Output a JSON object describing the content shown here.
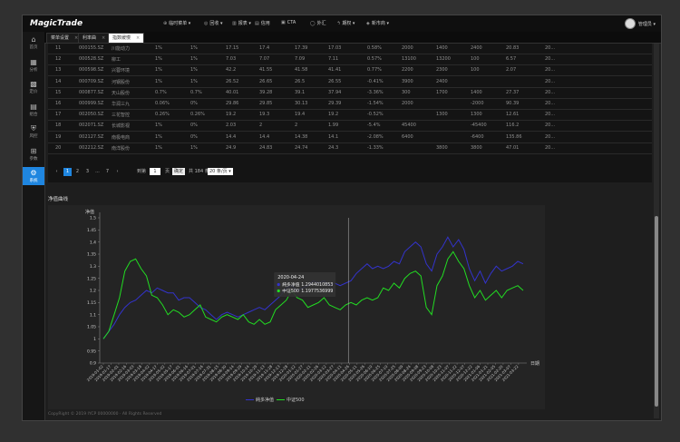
{
  "app": {
    "logo": "MagicTrade"
  },
  "topbar": {
    "menus": [
      {
        "icon": "⊕",
        "icon_name": "add-circle-icon",
        "label": "临时菜单 ▾"
      },
      {
        "icon": "◎",
        "icon_name": "target-icon",
        "label": "回收 ▾"
      },
      {
        "icon": "▥",
        "icon_name": "table-icon",
        "label": "报表 ▾"
      },
      {
        "icon": "▤",
        "icon_name": "doc-icon",
        "label": "信用"
      },
      {
        "icon": "▣",
        "icon_name": "cta-icon",
        "label": "CTA"
      },
      {
        "icon": "◯",
        "icon_name": "fx-icon",
        "label": "外汇"
      },
      {
        "icon": "ϟ",
        "icon_name": "bolt-icon",
        "label": "期权 ▾"
      },
      {
        "icon": "◈",
        "icon_name": "gem-icon",
        "label": "新市商 ▾"
      }
    ],
    "user": "管理员 ▾"
  },
  "sidebar": [
    {
      "icon": "⌂",
      "icon_name": "home-icon",
      "label": "首页"
    },
    {
      "icon": "▦",
      "icon_name": "box-icon",
      "label": "分析"
    },
    {
      "icon": "▩",
      "icon_name": "calendar-icon",
      "label": "定价"
    },
    {
      "icon": "▤",
      "icon_name": "layers-icon",
      "label": "组合"
    },
    {
      "icon": "⛨",
      "icon_name": "shield-icon",
      "label": "风控"
    },
    {
      "icon": "⊞",
      "icon_name": "grid-icon",
      "label": "参数"
    },
    {
      "icon": "⚙",
      "icon_name": "gear-icon",
      "label": "系统"
    }
  ],
  "tabs": [
    {
      "label": "菜单设置",
      "close": "×"
    },
    {
      "label": "利率曲",
      "close": "×"
    },
    {
      "label": "指数缓慢",
      "close": "×"
    }
  ],
  "table": {
    "rows": [
      [
        "11",
        "000155.SZ",
        "川能动力",
        "1%",
        "1%",
        "17.15",
        "17.4",
        "17.39",
        "17.03",
        "0.58%",
        "2000",
        "1400",
        "2400",
        "20.83",
        "20..."
      ],
      [
        "12",
        "000528.SZ",
        "柳工",
        "1%",
        "1%",
        "7.03",
        "7.07",
        "7.09",
        "7.11",
        "0.57%",
        "13100",
        "13200",
        "100",
        "6.57",
        "20..."
      ],
      [
        "13",
        "000598.SZ",
        "兴蓉环境",
        "1%",
        "1%",
        "42.2",
        "41.55",
        "41.58",
        "41.41",
        "0.77%",
        "2200",
        "2300",
        "100",
        "2.07",
        "20..."
      ],
      [
        "14",
        "000709.SZ",
        "河钢股份",
        "1%",
        "1%",
        "26.52",
        "26.65",
        "26.5",
        "26.55",
        "-0.41%",
        "3900",
        "2400",
        "",
        "",
        "20..."
      ],
      [
        "15",
        "000877.SZ",
        "天山股份",
        "0.7%",
        "0.7%",
        "40.01",
        "39.28",
        "39.1",
        "37.94",
        "-3.36%",
        "300",
        "1700",
        "1400",
        "27.37",
        "20..."
      ],
      [
        "16",
        "000999.SZ",
        "华润三九",
        "0.06%",
        "0%",
        "29.86",
        "29.85",
        "30.13",
        "29.39",
        "-1.54%",
        "2000",
        "",
        "-2000",
        "90.39",
        "20..."
      ],
      [
        "17",
        "002050.SZ",
        "三花智控",
        "0.26%",
        "0.26%",
        "19.2",
        "19.3",
        "19.4",
        "19.2",
        "-0.52%",
        "",
        "1300",
        "1300",
        "12.61",
        "20..."
      ],
      [
        "18",
        "002071.SZ",
        "长城影视",
        "1%",
        "0%",
        "2.03",
        "2",
        "2",
        "1.99",
        "-5.4%",
        "45400",
        "",
        "-45400",
        "116.2",
        "20..."
      ],
      [
        "19",
        "002127.SZ",
        "南极电商",
        "1%",
        "0%",
        "14.4",
        "14.4",
        "14.38",
        "14.1",
        "-2.08%",
        "6400",
        "",
        "-6400",
        "135.86",
        "20..."
      ],
      [
        "20",
        "002212.SZ",
        "南洋股份",
        "1%",
        "1%",
        "24.9",
        "24.83",
        "24.74",
        "24.3",
        "-1.33%",
        "",
        "3800",
        "3800",
        "47.01",
        "20..."
      ]
    ]
  },
  "pager": {
    "prev": "‹",
    "pages": [
      "1",
      "2",
      "3",
      "...",
      "7"
    ],
    "next": "›",
    "goto_label": "到第",
    "goto_value": "1",
    "page_unit": "页",
    "confirm": "确定",
    "total": "共 184 条",
    "page_size": "20 条/页 ▾"
  },
  "section_title": "净值曲线",
  "chart_data": {
    "type": "line",
    "title": "",
    "ylabel": "净值",
    "xlabel": "日期",
    "ylim": [
      0.9,
      1.5
    ],
    "yticks": [
      "0.9",
      "0.95",
      "1",
      "1.05",
      "1.1",
      "1.15",
      "1.2",
      "1.25",
      "1.3",
      "1.35",
      "1.4",
      "1.45",
      "1.5"
    ],
    "x_start": "2019-01-02",
    "x_end": "2021-03-31",
    "xtick_step_days": 15,
    "legend_position": "bottom",
    "series": [
      {
        "name": "純多净值",
        "color": "#3333cc",
        "values": [
          1.0,
          1.03,
          1.06,
          1.1,
          1.13,
          1.15,
          1.16,
          1.18,
          1.2,
          1.19,
          1.21,
          1.2,
          1.19,
          1.19,
          1.16,
          1.17,
          1.17,
          1.15,
          1.13,
          1.12,
          1.1,
          1.08,
          1.1,
          1.11,
          1.1,
          1.09,
          1.1,
          1.11,
          1.12,
          1.13,
          1.12,
          1.14,
          1.16,
          1.18,
          1.21,
          1.22,
          1.2,
          1.21,
          1.22,
          1.24,
          1.23,
          1.24,
          1.22,
          1.23,
          1.22,
          1.23,
          1.24,
          1.27,
          1.29,
          1.31,
          1.29,
          1.3,
          1.29,
          1.3,
          1.32,
          1.31,
          1.36,
          1.38,
          1.4,
          1.38,
          1.31,
          1.28,
          1.35,
          1.38,
          1.42,
          1.38,
          1.41,
          1.37,
          1.29,
          1.24,
          1.28,
          1.23,
          1.27,
          1.3,
          1.28,
          1.29,
          1.3,
          1.32,
          1.31
        ]
      },
      {
        "name": "中证500",
        "color": "#22dd22",
        "values": [
          1.0,
          1.03,
          1.1,
          1.17,
          1.28,
          1.32,
          1.33,
          1.29,
          1.26,
          1.18,
          1.17,
          1.14,
          1.1,
          1.12,
          1.11,
          1.09,
          1.1,
          1.12,
          1.14,
          1.09,
          1.08,
          1.07,
          1.09,
          1.1,
          1.09,
          1.08,
          1.1,
          1.07,
          1.06,
          1.08,
          1.06,
          1.07,
          1.12,
          1.14,
          1.16,
          1.2,
          1.17,
          1.16,
          1.13,
          1.14,
          1.15,
          1.17,
          1.14,
          1.13,
          1.12,
          1.14,
          1.15,
          1.14,
          1.16,
          1.17,
          1.16,
          1.17,
          1.21,
          1.2,
          1.23,
          1.21,
          1.25,
          1.27,
          1.28,
          1.26,
          1.13,
          1.1,
          1.22,
          1.26,
          1.33,
          1.36,
          1.32,
          1.29,
          1.22,
          1.17,
          1.2,
          1.16,
          1.18,
          1.2,
          1.17,
          1.2,
          1.21,
          1.22,
          1.2
        ]
      }
    ],
    "tooltip": {
      "date": "2020-04-24",
      "rows": [
        {
          "name": "純多净值",
          "value": "1.2944010853"
        },
        {
          "name": "中证500",
          "value": "1.1977536999"
        }
      ]
    }
  },
  "footer": "CopyRight © 2019 IYCP 00000000 · All Rights Reserved",
  "colors": {
    "accent": "#1f86e0",
    "series1": "#3333cc",
    "series2": "#22dd22"
  }
}
